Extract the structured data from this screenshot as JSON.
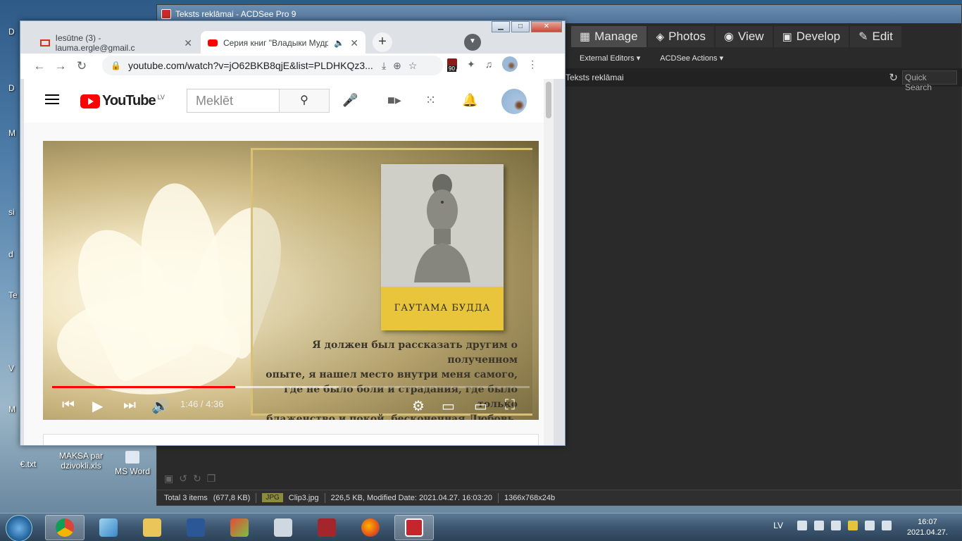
{
  "desktop": {
    "icons": [
      {
        "label": "€.txt"
      },
      {
        "label": "MAKSA par dzivokli.xls"
      },
      {
        "label": "MS Word"
      }
    ],
    "edge_labels": [
      "D",
      "D",
      "M",
      "si",
      "d",
      "Te",
      "V",
      "M"
    ]
  },
  "acdsee": {
    "title": "Teksts reklāmai - ACDSee Pro 9",
    "modes": [
      "Manage",
      "Photos",
      "View",
      "Develop",
      "Edit"
    ],
    "menus": [
      "External Editors",
      "ACDSee Actions"
    ],
    "path": "Teksts reklāmai",
    "quick_search_placeholder": "Quick Search",
    "status": {
      "total": "Total 3 items",
      "size": "(677,8 KB)",
      "type": "JPG",
      "filename": "Clip3.jpg",
      "details": "226,5 KB, Modified Date: 2021.04.27. 16:03:20",
      "dimensions": "1366x768x24b"
    }
  },
  "chrome": {
    "tabs": [
      {
        "label": "Iesūtne (3) - lauma.ergle@gmail.c"
      },
      {
        "label": "Серия книг \"Владыки Мудро"
      }
    ],
    "url": "youtube.com/watch?v=jO62BKB8qjE&list=PLDHKQz3...",
    "extension_badge": "90"
  },
  "youtube": {
    "logo_text": "YouTube",
    "region": "LV",
    "search_placeholder": "Meklēt"
  },
  "video": {
    "book_title": "ГАУТАМА БУДДА",
    "quote_lines": [
      "Я должен был рассказать другим о полученном",
      "опыте, я нашел место внутри меня самого,",
      "где не было боли и страдания, где было только",
      "блаженство и покой, бесконечная Любовь."
    ],
    "time": "1:46 / 4:36",
    "played_fraction": 0.384,
    "buffered_fraction": 0.6
  },
  "taskbar": {
    "language": "LV",
    "time": "16:07",
    "date": "2021.04.27."
  }
}
